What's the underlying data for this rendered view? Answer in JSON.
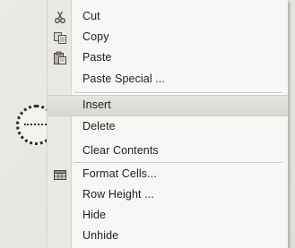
{
  "menu": {
    "items": [
      {
        "label": "Cut",
        "icon": "scissors-icon"
      },
      {
        "label": "Copy",
        "icon": "copy-icon"
      },
      {
        "label": "Paste",
        "icon": "paste-icon"
      },
      {
        "label": "Paste Special ...",
        "icon": ""
      },
      {
        "label": "Insert",
        "icon": ""
      },
      {
        "label": "Delete",
        "icon": ""
      },
      {
        "label": "Clear Contents",
        "icon": ""
      },
      {
        "label": "Format Cells...",
        "icon": "format-cells-icon"
      },
      {
        "label": "Row Height ...",
        "icon": ""
      },
      {
        "label": "Hide",
        "icon": ""
      },
      {
        "label": "Unhide",
        "icon": ""
      }
    ],
    "highlighted": "Insert"
  },
  "colors": {
    "menu_bg": "#f7f7f5",
    "gutter_bg": "#e9e8e4",
    "highlight_bg": "#dddcd7",
    "text": "#1f1f1f"
  }
}
